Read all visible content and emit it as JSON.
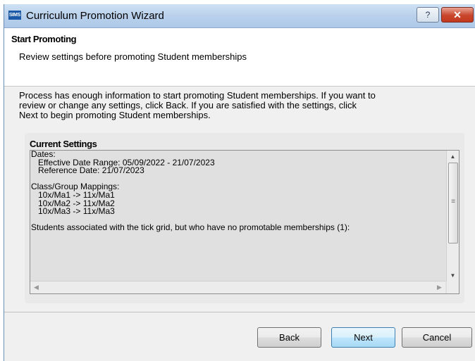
{
  "window": {
    "app_icon_text": "SIMS",
    "title": "Curriculum Promotion Wizard",
    "help_glyph": "?",
    "close_glyph": "✕"
  },
  "header": {
    "title": "Start Promoting",
    "subtitle": "Review settings before promoting Student memberships"
  },
  "intro": {
    "lines": [
      "Process has enough information to start promoting Student memberships.  If you want to",
      "review or change any settings, click Back.  If you are satisfied with the settings, click",
      "Next to begin promoting Student memberships."
    ]
  },
  "settings": {
    "group_title": "Current Settings",
    "lines": [
      "Dates:",
      "   Effective Date Range: 05/09/2022 - 21/07/2023",
      "   Reference Date: 21/07/2023",
      "",
      "Class/Group Mappings:",
      "   10x/Ma1 -> 11x/Ma1",
      "   10x/Ma2 -> 11x/Ma2",
      "   10x/Ma3 -> 11x/Ma3",
      "",
      "Students associated with the tick grid, but who have no promotable memberships (1):"
    ]
  },
  "buttons": {
    "back": "Back",
    "next": "Next",
    "cancel": "Cancel"
  }
}
